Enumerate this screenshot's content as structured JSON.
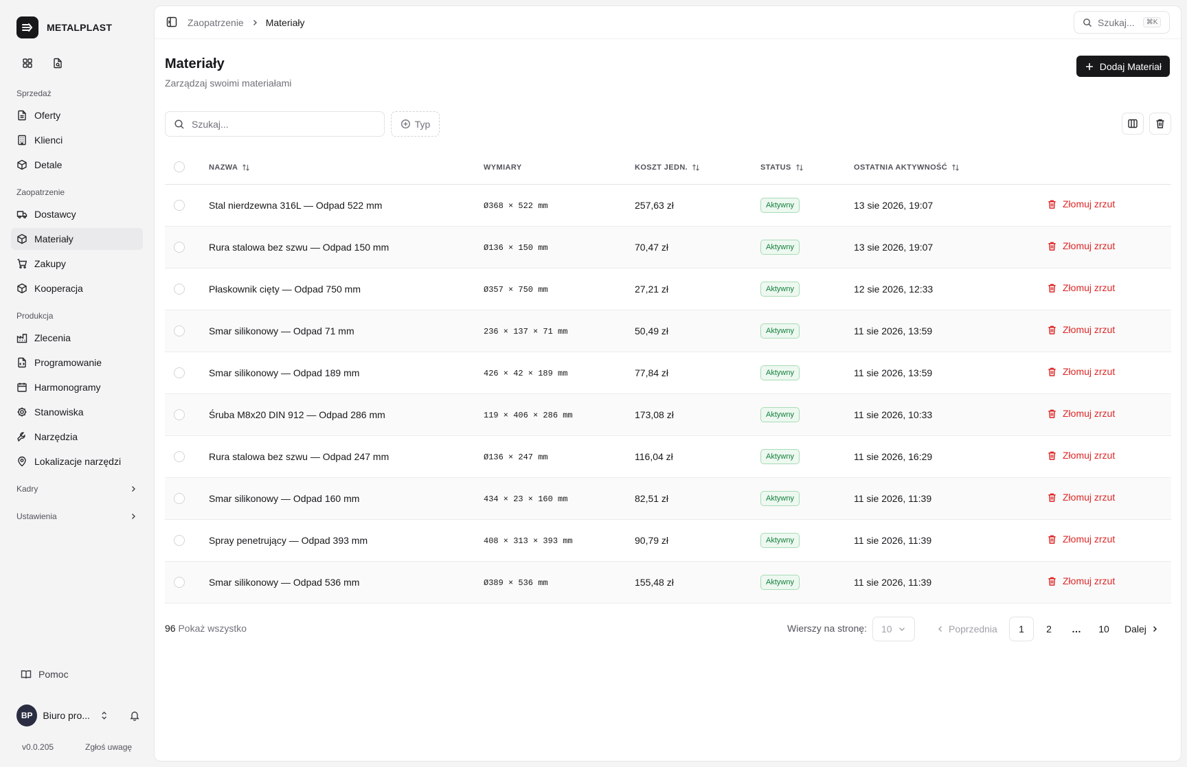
{
  "brand": {
    "name": "METALPLAST"
  },
  "sidebar": {
    "sections": [
      {
        "label": "Sprzedaż",
        "items": [
          {
            "label": "Oferty",
            "icon": "file-text-icon"
          },
          {
            "label": "Klienci",
            "icon": "building-icon"
          },
          {
            "label": "Detale",
            "icon": "box-icon"
          }
        ]
      },
      {
        "label": "Zaopatrzenie",
        "items": [
          {
            "label": "Dostawcy",
            "icon": "truck-icon"
          },
          {
            "label": "Materiały",
            "icon": "box-icon",
            "active": true
          },
          {
            "label": "Zakupy",
            "icon": "cart-icon"
          },
          {
            "label": "Kooperacja",
            "icon": "box-icon"
          }
        ]
      },
      {
        "label": "Produkcja",
        "items": [
          {
            "label": "Zlecenia",
            "icon": "factory-icon"
          },
          {
            "label": "Programowanie",
            "icon": "file-code-icon"
          },
          {
            "label": "Harmonogramy",
            "icon": "calendar-icon"
          },
          {
            "label": "Stanowiska",
            "icon": "cog-icon"
          },
          {
            "label": "Narzędzia",
            "icon": "wrench-icon"
          },
          {
            "label": "Lokalizacje narzędzi",
            "icon": "map-pin-icon"
          }
        ]
      }
    ],
    "groups": [
      "Kadry",
      "Ustawienia"
    ],
    "help": "Pomoc",
    "user": {
      "initials": "BP",
      "name": "Biuro pro..."
    },
    "version": "v0.0.205",
    "feedback": "Zgłoś uwagę"
  },
  "topbar": {
    "breadcrumb": {
      "parent": "Zaopatrzenie",
      "current": "Materiały"
    },
    "search_placeholder": "Szukaj...",
    "shortcut": "⌘K"
  },
  "page": {
    "title": "Materiały",
    "subtitle": "Zarządzaj swoimi materiałami",
    "add_button": "Dodaj Materiał",
    "search_placeholder": "Szukaj...",
    "type_filter": "Typ"
  },
  "table": {
    "columns": {
      "name": "NAZWA",
      "dims": "WYMIARY",
      "cost": "KOSZT JEDN.",
      "status": "STATUS",
      "activity": "OSTATNIA AKTYWNOŚĆ"
    },
    "action_label": "Złomuj zrzut",
    "rows": [
      {
        "name": "Stal nierdzewna 316L — Odpad 522 mm",
        "dims": "Ø368 × 522 mm",
        "cost": "257,63 zł",
        "status": "Aktywny",
        "activity": "13 sie 2026, 19:07"
      },
      {
        "name": "Rura stalowa bez szwu — Odpad 150 mm",
        "dims": "Ø136 × 150 mm",
        "cost": "70,47 zł",
        "status": "Aktywny",
        "activity": "13 sie 2026, 19:07"
      },
      {
        "name": "Płaskownik cięty — Odpad 750 mm",
        "dims": "Ø357 × 750 mm",
        "cost": "27,21 zł",
        "status": "Aktywny",
        "activity": "12 sie 2026, 12:33"
      },
      {
        "name": "Smar silikonowy — Odpad 71 mm",
        "dims": "236 × 137 × 71 mm",
        "cost": "50,49 zł",
        "status": "Aktywny",
        "activity": "11 sie 2026, 13:59"
      },
      {
        "name": "Smar silikonowy — Odpad 189 mm",
        "dims": "426 × 42 × 189 mm",
        "cost": "77,84 zł",
        "status": "Aktywny",
        "activity": "11 sie 2026, 13:59"
      },
      {
        "name": "Śruba M8x20 DIN 912 — Odpad 286 mm",
        "dims": "119 × 406 × 286 mm",
        "cost": "173,08 zł",
        "status": "Aktywny",
        "activity": "11 sie 2026, 10:33"
      },
      {
        "name": "Rura stalowa bez szwu — Odpad 247 mm",
        "dims": "Ø136 × 247 mm",
        "cost": "116,04 zł",
        "status": "Aktywny",
        "activity": "11 sie 2026, 16:29"
      },
      {
        "name": "Smar silikonowy — Odpad 160 mm",
        "dims": "434 × 23 × 160 mm",
        "cost": "82,51 zł",
        "status": "Aktywny",
        "activity": "11 sie 2026, 11:39"
      },
      {
        "name": "Spray penetrujący — Odpad 393 mm",
        "dims": "408 × 313 × 393 mm",
        "cost": "90,79 zł",
        "status": "Aktywny",
        "activity": "11 sie 2026, 11:39"
      },
      {
        "name": "Smar silikonowy — Odpad 536 mm",
        "dims": "Ø389 × 536 mm",
        "cost": "155,48 zł",
        "status": "Aktywny",
        "activity": "11 sie 2026, 11:39"
      }
    ]
  },
  "footer": {
    "total": "96",
    "show_all": "Pokaż wszystko",
    "rows_label": "Wierszy na stronę:",
    "rows_value": "10",
    "prev": "Poprzednia",
    "pages": [
      "1",
      "2",
      "…",
      "10"
    ],
    "current_page": "1",
    "next": "Dalej"
  },
  "colors": {
    "accent": "#18181b",
    "danger": "#dc2626",
    "success": "#15803d",
    "success_bg": "#edf8f0"
  }
}
